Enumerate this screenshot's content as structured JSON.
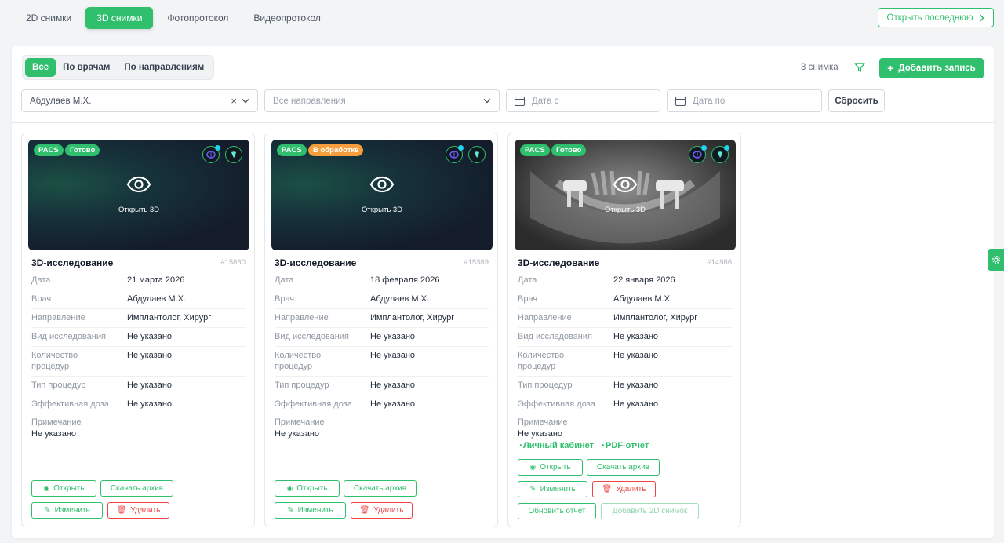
{
  "top_tabs": [
    {
      "label": "2D снимки",
      "active": false
    },
    {
      "label": "3D снимки",
      "active": true
    },
    {
      "label": "Фотопротокол",
      "active": false
    },
    {
      "label": "Видеопротокол",
      "active": false
    }
  ],
  "open_last_label": "Открыть последнюю",
  "segments": [
    {
      "label": "Все",
      "active": true
    },
    {
      "label": "По врачам",
      "active": false
    },
    {
      "label": "По направлениям",
      "active": false
    }
  ],
  "count_text": "3 снимка",
  "add_label": "Добавить запись",
  "filters": {
    "doctor_value": "Абдулаев М.Х.",
    "direction_placeholder": "Все направления",
    "date_from_placeholder": "Дата с",
    "date_to_placeholder": "Дата по",
    "reset_label": "Сбросить"
  },
  "field_labels": {
    "date": "Дата",
    "doctor": "Врач",
    "direction": "Направление",
    "study_type": "Вид исследования",
    "procedure_count": "Количество процедур",
    "procedure_type": "Тип процедур",
    "dose": "Эффективная доза",
    "note": "Примечание"
  },
  "button_labels": {
    "open": "Открыть",
    "download": "Скачать архив",
    "edit": "Изменить",
    "delete": "Удалить",
    "update_report": "Обновить отчет",
    "add_2d": "Добавить 2D снимок",
    "open_3d": "Открыть 3D",
    "pacs": "PACS",
    "personal_cabinet": "Личный кабинет",
    "pdf_report": "PDF-отчет"
  },
  "cards": [
    {
      "title": "3D-исследование",
      "id": "#15860",
      "status": "Готово",
      "status_color": "#2fbf6d",
      "date": "21 марта 2026",
      "doctor": "Абдулаев М.Х.",
      "direction": "Имплантолог, Хирург",
      "study_type": "Не указано",
      "procedure_count": "Не указано",
      "procedure_type": "Не указано",
      "dose": "Не указано",
      "note": "Не указано"
    },
    {
      "title": "3D-исследование",
      "id": "#15389",
      "status": "В обработке",
      "status_color": "#f59e3b",
      "date": "18 февраля 2026",
      "doctor": "Абдулаев М.Х.",
      "direction": "Имплантолог, Хирург",
      "study_type": "Не указано",
      "procedure_count": "Не указано",
      "procedure_type": "Не указано",
      "dose": "Не указано",
      "note": "Не указано"
    },
    {
      "title": "3D-исследование",
      "id": "#14986",
      "status": "Готово",
      "status_color": "#2fbf6d",
      "date": "22 января 2026",
      "doctor": "Абдулаев М.Х.",
      "direction": "Имплантолог, Хирург",
      "study_type": "Не указано",
      "procedure_count": "Не указано",
      "procedure_type": "Не указано",
      "dose": "Не указано",
      "note": "Не указано"
    }
  ],
  "colors": {
    "accent": "#2fbf6d",
    "danger": "#ef4444",
    "processing": "#f59e3b"
  },
  "icons": [
    "eye-icon",
    "filter-icon",
    "plus-icon",
    "calendar-icon",
    "close-icon",
    "chevron-down-icon",
    "chevron-right-icon",
    "pencil-icon",
    "trash-icon",
    "gear-icon",
    "tooth-icon",
    "brain-icon"
  ]
}
